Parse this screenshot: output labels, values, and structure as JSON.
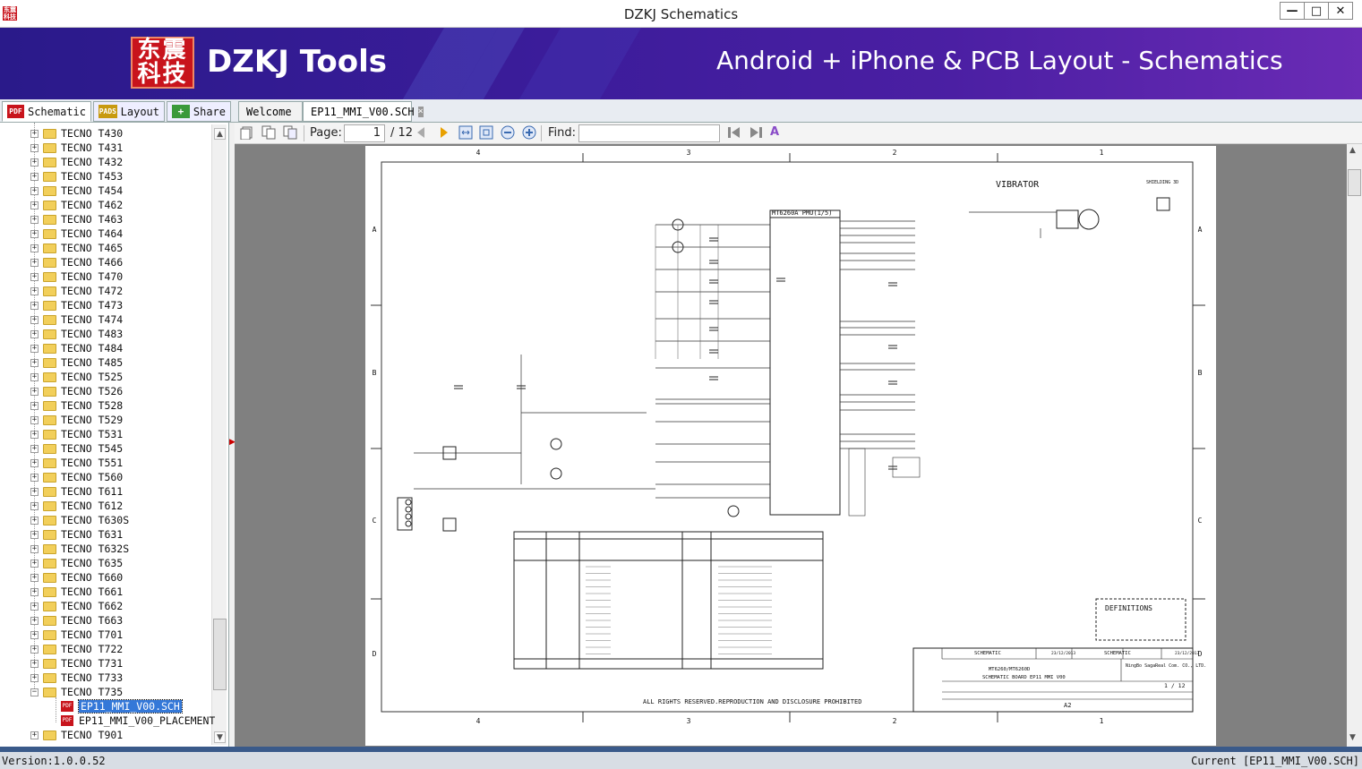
{
  "window": {
    "title": "DZKJ Schematics",
    "icon_text": "东震科技",
    "minimize": "—",
    "maximize": "□",
    "close": "✕"
  },
  "banner": {
    "logo_text": "东震科技",
    "brand": "DZKJ Tools",
    "tagline": "Android + iPhone & PCB Layout - Schematics"
  },
  "tabs": [
    {
      "label": "Schematic",
      "icon": "PDF"
    },
    {
      "label": "Layout",
      "icon": "PADS"
    },
    {
      "label": "Share",
      "icon": "share-icon"
    }
  ],
  "doc_tabs": [
    {
      "label": "Welcome"
    },
    {
      "label": "EP11_MMI_V00.SCH"
    }
  ],
  "tree": {
    "items": [
      "TECNO T430",
      "TECNO T431",
      "TECNO T432",
      "TECNO T453",
      "TECNO T454",
      "TECNO T462",
      "TECNO T463",
      "TECNO T464",
      "TECNO T465",
      "TECNO T466",
      "TECNO T470",
      "TECNO T472",
      "TECNO T473",
      "TECNO T474",
      "TECNO T483",
      "TECNO T484",
      "TECNO T485",
      "TECNO T525",
      "TECNO T526",
      "TECNO T528",
      "TECNO T529",
      "TECNO T531",
      "TECNO T545",
      "TECNO T551",
      "TECNO T560",
      "TECNO T611",
      "TECNO T612",
      "TECNO T630S",
      "TECNO T631",
      "TECNO T632S",
      "TECNO T635",
      "TECNO T660",
      "TECNO T661",
      "TECNO T662",
      "TECNO T663",
      "TECNO T701",
      "TECNO T722",
      "TECNO T731",
      "TECNO T733",
      "TECNO T735"
    ],
    "children": [
      "EP11_MMI_V00.SCH",
      "EP11_MMI_V00_PLACEMENT"
    ],
    "after": [
      "TECNO T901"
    ]
  },
  "toolbar": {
    "page_label": "Page:",
    "page_value": "1",
    "page_total": "/ 12",
    "find_label": "Find:",
    "find_value": ""
  },
  "schematic": {
    "col_labels": [
      "4",
      "3",
      "2",
      "1"
    ],
    "row_labels": [
      "A",
      "B",
      "C",
      "D"
    ],
    "vibrator": "VIBRATOR",
    "pmu": "MT6260A PMU(1/5)",
    "definitions": "DEFINITIONS",
    "rights": "ALL RIGHTS RESERVED.REPRODUCTION AND DISCLOSURE PROHIBITED",
    "title_1": "MT6260/MT6260D",
    "title_2": "SCHEMATIC BOARD EP11 MMI V00",
    "name_1": "SCHEMATIC",
    "name_2": "SCHEMATIC",
    "date_1": "23/12/2013",
    "date_2": "23/12/2013",
    "company": "NingBo SagaReal Com. CO., LTD.",
    "sheet": "1 / 12",
    "size": "A2",
    "shielding": "SHIELDING 3D"
  },
  "status": {
    "version": "Version:1.0.0.52",
    "current": "Current [EP11_MMI_V00.SCH]"
  }
}
